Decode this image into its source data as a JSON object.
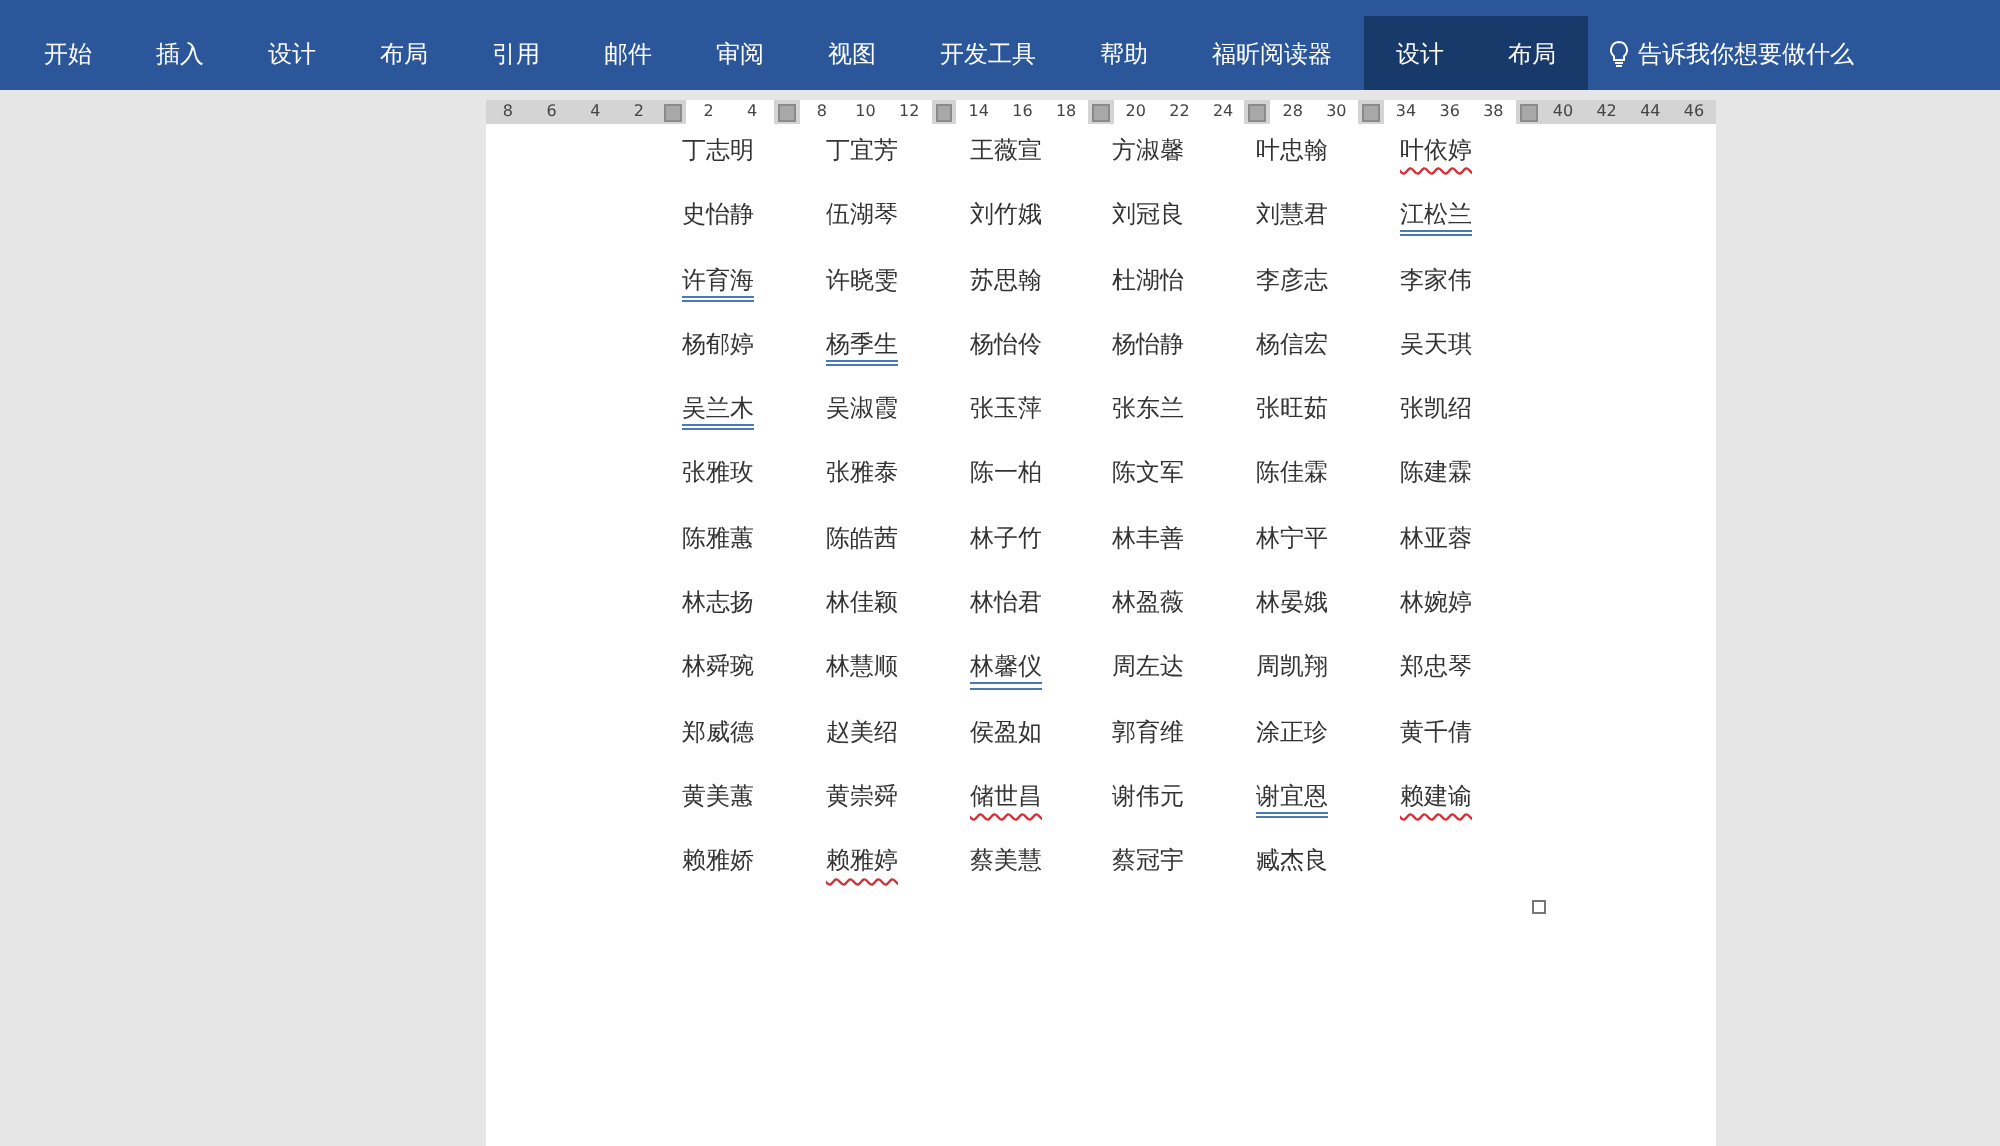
{
  "ribbon": {
    "tabs": [
      {
        "label": "开始",
        "contextual": false
      },
      {
        "label": "插入",
        "contextual": false
      },
      {
        "label": "设计",
        "contextual": false
      },
      {
        "label": "布局",
        "contextual": false
      },
      {
        "label": "引用",
        "contextual": false
      },
      {
        "label": "邮件",
        "contextual": false
      },
      {
        "label": "审阅",
        "contextual": false
      },
      {
        "label": "视图",
        "contextual": false
      },
      {
        "label": "开发工具",
        "contextual": false
      },
      {
        "label": "帮助",
        "contextual": false
      },
      {
        "label": "福昕阅读器",
        "contextual": false
      },
      {
        "label": "设计",
        "contextual": true
      },
      {
        "label": "布局",
        "contextual": true
      }
    ],
    "tell_me": "告诉我你想要做什么"
  },
  "ruler": [
    {
      "kind": "label",
      "text": "8",
      "shaded": true
    },
    {
      "kind": "label",
      "text": "6",
      "shaded": true
    },
    {
      "kind": "label",
      "text": "4",
      "shaded": true
    },
    {
      "kind": "label",
      "text": "2",
      "shaded": true
    },
    {
      "kind": "marker"
    },
    {
      "kind": "label",
      "text": "2",
      "shaded": false
    },
    {
      "kind": "label",
      "text": "4",
      "shaded": false
    },
    {
      "kind": "marker"
    },
    {
      "kind": "label",
      "text": "8",
      "shaded": false
    },
    {
      "kind": "label",
      "text": "10",
      "shaded": false
    },
    {
      "kind": "label",
      "text": "12",
      "shaded": false
    },
    {
      "kind": "marker"
    },
    {
      "kind": "label",
      "text": "14",
      "shaded": false
    },
    {
      "kind": "label",
      "text": "16",
      "shaded": false
    },
    {
      "kind": "label",
      "text": "18",
      "shaded": false
    },
    {
      "kind": "marker"
    },
    {
      "kind": "label",
      "text": "20",
      "shaded": false
    },
    {
      "kind": "label",
      "text": "22",
      "shaded": false
    },
    {
      "kind": "label",
      "text": "24",
      "shaded": false
    },
    {
      "kind": "marker"
    },
    {
      "kind": "label",
      "text": "28",
      "shaded": false
    },
    {
      "kind": "label",
      "text": "30",
      "shaded": false
    },
    {
      "kind": "marker"
    },
    {
      "kind": "label",
      "text": "34",
      "shaded": false
    },
    {
      "kind": "label",
      "text": "36",
      "shaded": false
    },
    {
      "kind": "label",
      "text": "38",
      "shaded": false
    },
    {
      "kind": "marker"
    },
    {
      "kind": "label",
      "text": "40",
      "shaded": true
    },
    {
      "kind": "label",
      "text": "42",
      "shaded": true
    },
    {
      "kind": "label",
      "text": "44",
      "shaded": true
    },
    {
      "kind": "label",
      "text": "46",
      "shaded": true
    }
  ],
  "document": {
    "names": [
      {
        "text": "丁志明"
      },
      {
        "text": "丁宜芳"
      },
      {
        "text": "王薇宣"
      },
      {
        "text": "方淑馨"
      },
      {
        "text": "叶忠翰"
      },
      {
        "text": "叶依婷",
        "spelling_error": true
      },
      {
        "text": "史怡静"
      },
      {
        "text": "伍湖琴"
      },
      {
        "text": "刘竹娥"
      },
      {
        "text": "刘冠良"
      },
      {
        "text": "刘慧君"
      },
      {
        "text": "江松兰",
        "grammar_error": true
      },
      {
        "text": "许育海",
        "grammar_error": true
      },
      {
        "text": "许晓雯"
      },
      {
        "text": "苏思翰"
      },
      {
        "text": "杜湖怡"
      },
      {
        "text": "李彦志"
      },
      {
        "text": "李家伟"
      },
      {
        "text": "杨郁婷"
      },
      {
        "text": "杨季生",
        "grammar_error": true
      },
      {
        "text": "杨怡伶"
      },
      {
        "text": "杨怡静"
      },
      {
        "text": "杨信宏"
      },
      {
        "text": "吴天琪"
      },
      {
        "text": "吴兰木",
        "grammar_error": true
      },
      {
        "text": "吴淑霞"
      },
      {
        "text": "张玉萍"
      },
      {
        "text": "张东兰"
      },
      {
        "text": "张旺茹"
      },
      {
        "text": "张凯绍"
      },
      {
        "text": "张雅玫"
      },
      {
        "text": "张雅泰"
      },
      {
        "text": "陈一柏"
      },
      {
        "text": "陈文军"
      },
      {
        "text": "陈佳霖"
      },
      {
        "text": "陈建霖"
      },
      {
        "text": "陈雅蕙"
      },
      {
        "text": "陈皓茜"
      },
      {
        "text": "林子竹"
      },
      {
        "text": "林丰善"
      },
      {
        "text": "林宁平"
      },
      {
        "text": "林亚蓉"
      },
      {
        "text": "林志扬"
      },
      {
        "text": "林佳颖"
      },
      {
        "text": "林怡君"
      },
      {
        "text": "林盈薇"
      },
      {
        "text": "林晏娥"
      },
      {
        "text": "林婉婷"
      },
      {
        "text": "林舜琬"
      },
      {
        "text": "林慧顺"
      },
      {
        "text": "林馨仪",
        "grammar_error": true
      },
      {
        "text": "周左达"
      },
      {
        "text": "周凯翔"
      },
      {
        "text": "郑忠琴"
      },
      {
        "text": "郑威德"
      },
      {
        "text": "赵美绍"
      },
      {
        "text": "侯盈如"
      },
      {
        "text": "郭育维"
      },
      {
        "text": "涂正珍"
      },
      {
        "text": "黄千倩"
      },
      {
        "text": "黄美蕙"
      },
      {
        "text": "黄崇舜"
      },
      {
        "text": "储世昌",
        "spelling_error": true
      },
      {
        "text": "谢伟元"
      },
      {
        "text": "谢宜恩",
        "grammar_error": true
      },
      {
        "text": "赖建谕",
        "spelling_error": true
      },
      {
        "text": "赖雅娇"
      },
      {
        "text": "赖雅婷",
        "spelling_error": true
      },
      {
        "text": "蔡美慧"
      },
      {
        "text": "蔡冠宇"
      },
      {
        "text": "臧杰良"
      }
    ]
  }
}
